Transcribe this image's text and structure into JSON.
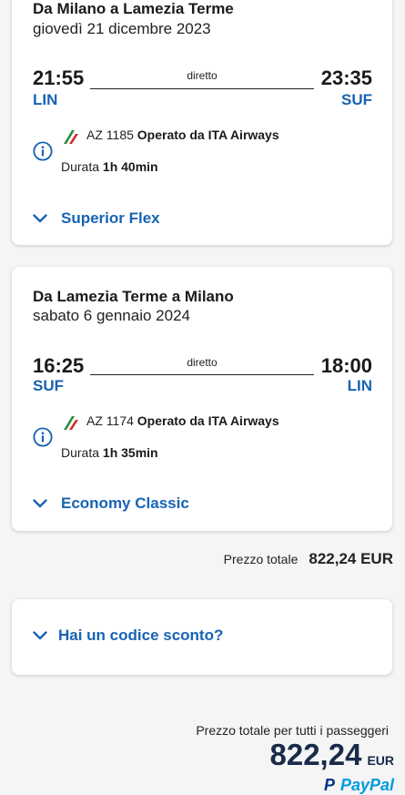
{
  "outbound": {
    "route": "Da Milano a Lamezia Terme",
    "date": "giovedì 21 dicembre 2023",
    "depart_time": "21:55",
    "depart_code": "LIN",
    "arrive_time": "23:35",
    "arrive_code": "SUF",
    "stops": "diretto",
    "flight_number": "AZ 1185",
    "operated_by": "Operato da ITA Airways",
    "duration_label": "Durata",
    "duration_value": "1h 40min",
    "fare": "Superior Flex"
  },
  "inbound": {
    "route": "Da Lamezia Terme a Milano",
    "date": "sabato 6 gennaio 2024",
    "depart_time": "16:25",
    "depart_code": "SUF",
    "arrive_time": "18:00",
    "arrive_code": "LIN",
    "stops": "diretto",
    "flight_number": "AZ 1174",
    "operated_by": "Operato da ITA Airways",
    "duration_label": "Durata",
    "duration_value": "1h 35min",
    "fare": "Economy Classic"
  },
  "total": {
    "label": "Prezzo totale",
    "value": "822,24 EUR"
  },
  "discount": {
    "label": "Hai un codice sconto?"
  },
  "grand_total": {
    "label": "Prezzo totale per tutti i passeggeri",
    "amount": "822,24",
    "currency": "EUR"
  },
  "payment": {
    "brand": "PayPal"
  },
  "colors": {
    "accent": "#1763b4",
    "text": "#1a1a1a",
    "logo_green": "#2e8b3a",
    "logo_red": "#d42a2a"
  },
  "icons": {
    "info": "info-circle-icon",
    "chevron": "chevron-down-icon",
    "airline": "ita-airways-logo"
  }
}
